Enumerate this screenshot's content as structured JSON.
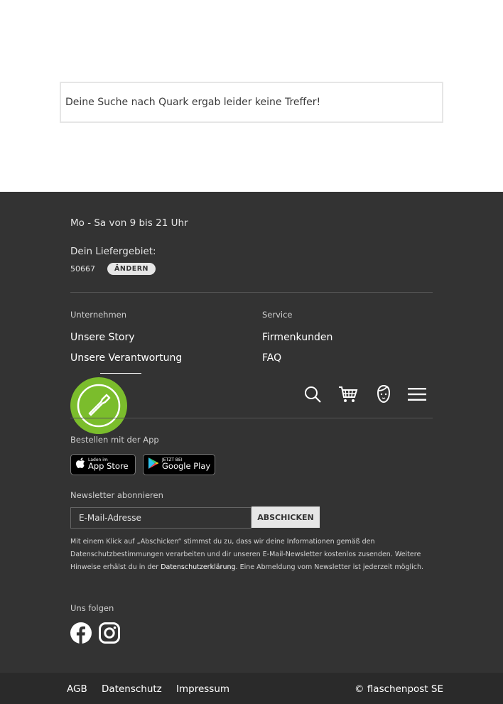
{
  "search": {
    "message": "Deine Suche nach Quark ergab leider keine Treffer!"
  },
  "footer": {
    "hours": "Mo - Sa von 9 bis 21 Uhr",
    "delivery_label": "Dein Liefergebiet:",
    "zip": "50667",
    "change_label": "ÄNDERN",
    "company_heading": "Unternehmen",
    "company_links": [
      "Unsere Story",
      "Unsere Verantwortung"
    ],
    "service_heading": "Service",
    "service_links": [
      "Firmenkunden",
      "FAQ"
    ],
    "app_heading": "Bestellen mit der App",
    "appstore": {
      "small": "Laden im",
      "big": "App Store"
    },
    "playstore": {
      "small": "JETZT BEI",
      "big": "Google Play"
    },
    "newsletter_heading": "Newsletter abonnieren",
    "newsletter_placeholder": "E-Mail-Adresse",
    "newsletter_button": "ABSCHICKEN",
    "newsletter_note_before": "Mit einem Klick auf „Abschicken“ stimmst du zu, dass wir deine Informationen gemäß den Datenschutzbestimmungen verarbeiten und dir unseren E-Mail-Newsletter kostenlos zusenden. Weitere Hinweise erhälst du in der ",
    "newsletter_note_link": "Datenschutzerklärung",
    "newsletter_note_after": ". Eine Abmeldung vom Newsletter ist jederzeit möglich.",
    "follow_heading": "Uns folgen"
  },
  "legal": {
    "agb": "AGB",
    "privacy": "Datenschutz",
    "imprint": "Impressum",
    "copyright": "© flaschenpost SE"
  },
  "icons": {
    "logo": "bottle-logo-icon",
    "search": "search-icon",
    "cart": "cart-icon",
    "account": "user-face-icon",
    "menu": "hamburger-menu-icon",
    "facebook": "facebook-icon",
    "instagram": "instagram-icon",
    "apple": "apple-icon",
    "play": "google-play-icon"
  },
  "colors": {
    "brand_green": "#7bbd2c",
    "footer_bg": "#333333"
  }
}
